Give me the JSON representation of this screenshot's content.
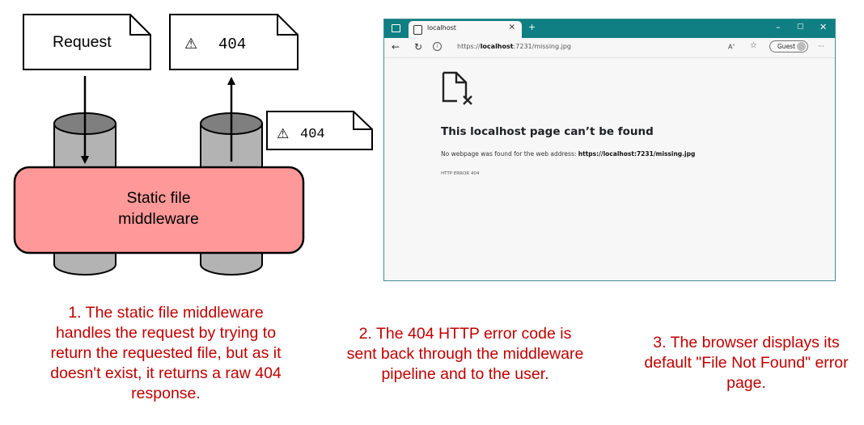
{
  "diagram": {
    "request_label": "Request",
    "response_status": "404",
    "returned_status": "404",
    "warning_glyph": "⚠",
    "middleware_line1": "Static file",
    "middleware_line2": "middleware",
    "colors": {
      "middleware_fill": "#ff9999",
      "cylinder_fill": "#b3b3b3",
      "caption": "#c00000"
    }
  },
  "captions": {
    "step1": "1. The static file middleware handles the request by trying to return the requested file, but as it doesn't exist, it returns a raw 404 response.",
    "step2": "2. The 404 HTTP error code is sent back through the middleware pipeline and to the user.",
    "step3": "3. The browser displays its default \"File Not Found\" error page."
  },
  "browser": {
    "tab_title": "localhost",
    "url_prefix": "https://",
    "url_host": "localhost",
    "url_rest": ":7231/missing.jpg",
    "guest_label": "Guest",
    "error_heading": "This localhost page can’t be found",
    "error_message": "No webpage was found for the web address:",
    "error_url": "https://localhost:7231/missing.jpg",
    "error_code": "HTTP ERROR 404",
    "colors": {
      "titlebar": "#0f7f83"
    }
  }
}
